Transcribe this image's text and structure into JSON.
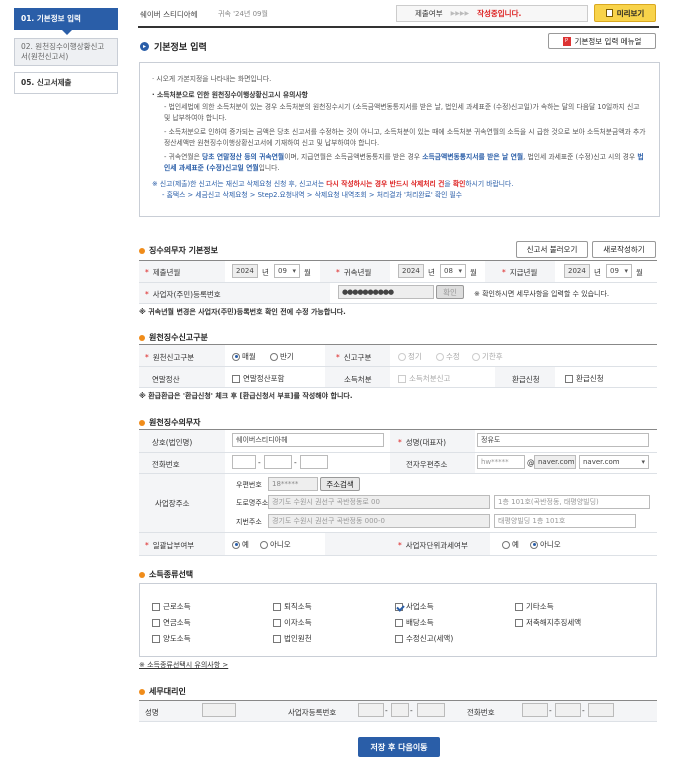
{
  "sidebar": {
    "steps": [
      {
        "label": "01. 기본정보 입력"
      },
      {
        "label": "02. 원천징수이행상황신고서(원천신고서)"
      },
      {
        "label": "05. 신고서제출"
      }
    ]
  },
  "header": {
    "company": "쉐이버 스티디아헤",
    "period": "귀속 '24년 09월",
    "submit_status_label": "제출여부",
    "arrows": "▶▶▶▶",
    "status_text": "작성중입니다.",
    "preview_button": "미리보기",
    "page_title": "기본정보 입력",
    "menual_button": "기본정보 입력 메뉴얼"
  },
  "notice": {
    "line1": "· 시오게 가본지정을 나타내는 화면입니다.",
    "heading": "· 소득처분으로 인한 원천징수이행상황신고시 유의사항",
    "p1": "- 법인세법에 의한 소득처분이 있는 경우 소득처분의 원천징수시기 (소득금액변동통지서를 받은 날, 법인세 과세표준 (수정)신고일)가 속하는 달의 다음달 10일까지 신고 및 납부하여야 합니다.",
    "p2": "- 소득처분으로 인하여 증가되는 금액은 당초 신고서를 수정하는 것이 아니고, 소득처분이 있는 때에 소득처분 귀속연월의 소득을 시 급한 것으로 보아 소득처분금액과 추가 정산세액만 원천징수이행상황신고서에 기재하여 신고 및 납부하여야 합니다.",
    "p3a": "- 귀속연월은 ",
    "p3b": "당초 연말정산 등의 귀속연월",
    "p3c": "이며, 지급연월은 소득금액변동통지를 받은 경우 ",
    "p3d": "소득금액변동통지서를 받은 날 연월",
    "p3e": ", 법인세 과세표준 (수정)신고 시의 경우 ",
    "p3f": "법인세 과세표준 (수정)신고일 연월",
    "p3g": "입니다.",
    "p4a": "※ 신고(제출)한 신고서는 재신고 삭제요청 신청 후, 신고서는 ",
    "p4b": "다시 작성하시는 경우 반드시 삭제처리 건",
    "p4c": "을 ",
    "p4d": "확인",
    "p4e": "하시기 바랍니다.",
    "p5": "- 홈택스 > 세금신고 삭제요청 > Step2.요청내역 > 삭제요청 내역조회 > 처리결과 '처리완료' 확인 필수"
  },
  "withholder": {
    "title": "징수의무자 기본정보",
    "load_button": "신고서 불러오기",
    "new_button": "새로작성하기",
    "submit_year_label": "제출년월",
    "submit_year": "2024",
    "submit_month": "09",
    "year_unit": "년",
    "month_unit": "월",
    "attr_year_label": "귀속년월",
    "attr_year": "2024",
    "attr_month": "08",
    "pay_year_label": "지급년월",
    "pay_year": "2024",
    "pay_month": "09",
    "biz_no_label": "사업자(주민)등록번호",
    "biz_no": "●●●●●●●●●●",
    "confirm_button": "확인",
    "biz_hint": "※ 확인하시면 세무사항을 입력할 수 있습니다.",
    "warning": "※ 귀속년월 변경은 사업자(주민)등록번호 확인 전에 수정 가능합니다."
  },
  "report_type": {
    "title": "원천징수신고구분",
    "kind_label": "원천신고구분",
    "monthly": "매월",
    "half": "반기",
    "report_label": "신고구분",
    "regular": "정기",
    "amend": "수정",
    "late": "기한후",
    "yearend_label": "연말정산",
    "yearend_cb": "연말정산포함",
    "income_label": "소득처분",
    "income_cb": "소득처분신고",
    "refund_label": "환급신청",
    "refund_cb": "환급신청",
    "warning": "※ 환급환급은 '환급신청' 체크 후 [환급신청서 부표]를 작성해야 합니다."
  },
  "obligor": {
    "title": "원천징수의무자",
    "company_label": "상호(법인명)",
    "company": "쉐이버스티디아헤",
    "ceo_label": "성명(대표자)",
    "ceo": "정유도",
    "phone_label": "전화번호",
    "email_label": "전자우편주소",
    "email_id": "hw*****",
    "at": "@",
    "email_domain": "naver.com",
    "email_select": "naver.com",
    "addr_label": "사업장주소",
    "zip_label": "우편번호",
    "zip": "18*****",
    "zip_button": "주소검색",
    "road_label": "도로명주소",
    "road": "경기도 수원시 권선구 곡반정동로 00",
    "road_detail": "1층 101호(곡반정동, 태평양빌딩)",
    "jibun_label": "지번주소",
    "jibun": "경기도 수원시 권선구 곡반정동 000-0",
    "jibun_detail": "태평양빌딩 1층 101호",
    "bulk_label": "일괄납부여부",
    "yes": "예",
    "no": "아니오",
    "unit_label": "사업자단위과세여부",
    "yes2": "예",
    "no2": "아니오"
  },
  "income_types": {
    "title": "소득종류선택",
    "items": [
      {
        "label": "근로소득",
        "checked": false
      },
      {
        "label": "퇴직소득",
        "checked": false
      },
      {
        "label": "사업소득",
        "checked": true
      },
      {
        "label": "기타소득",
        "checked": false
      },
      {
        "label": "연금소득",
        "checked": false
      },
      {
        "label": "이자소득",
        "checked": false
      },
      {
        "label": "배당소득",
        "checked": false
      },
      {
        "label": "저축해지추징세액",
        "checked": false
      },
      {
        "label": "양도소득",
        "checked": false
      },
      {
        "label": "법인원천",
        "checked": false
      },
      {
        "label": "수정신고(세액)",
        "checked": false
      }
    ],
    "link": "※ 소득종류선택시 유의사항 >"
  },
  "agent": {
    "title": "세무대리인",
    "name_label": "성명",
    "biz_label": "사업자등록번호",
    "phone_label": "전화번호"
  },
  "footer": {
    "save_button": "저장 후 다음이동"
  },
  "colors": {
    "primary": "#2a5ea8",
    "accent": "#f08c1a",
    "warning": "#d22222"
  }
}
